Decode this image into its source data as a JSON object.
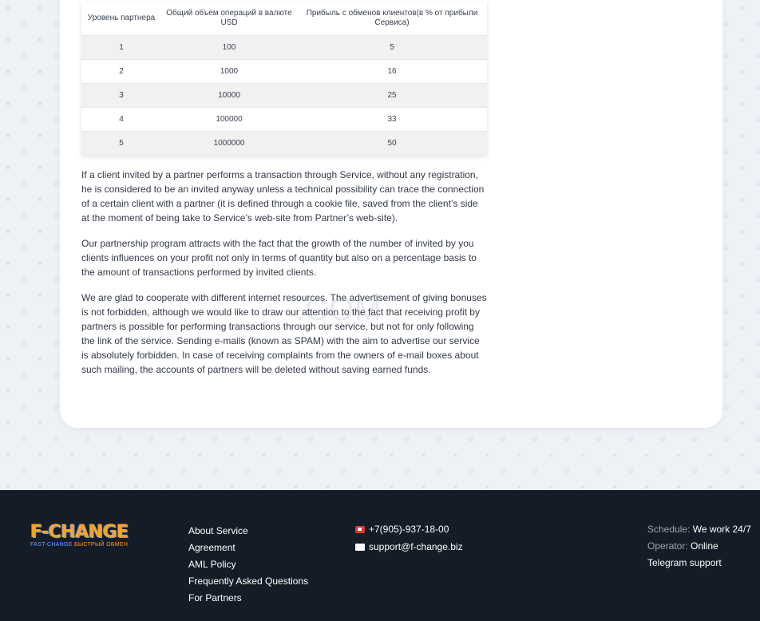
{
  "table": {
    "headers": [
      "Уровень партнера",
      "Общий объем операций в валюте USD",
      "Прибыль с обменов клиентов(в % от прибыли Сервиса)"
    ],
    "rows": [
      [
        "1",
        "100",
        "5"
      ],
      [
        "2",
        "1000",
        "16"
      ],
      [
        "3",
        "10000",
        "25"
      ],
      [
        "4",
        "100000",
        "33"
      ],
      [
        "5",
        "1000000",
        "50"
      ]
    ]
  },
  "paragraphs": [
    "If a client invited by a partner performs a transaction through Service, without any registration, he is considered to be an invited anyway unless a technical possibility can trace the connection of a certain client with a partner (it is defined through a cookie file, saved from the client’s side at the moment of being take to Service’s web-site from Partner’s web-site).",
    "Our partnership program attracts with the fact that the growth of the number of invited by you clients influences on your profit not only in terms of quantity but also on a percentage basis to the amount of transactions performed by invited clients.",
    "We are glad to cooperate with different internet resources. The advertisement of giving bonuses is not forbidden, although we would like to draw our attention to the fact that receiving profit by partners is possible for performing transactions through our service, but not for only following the link of the service. Sending e-mails (known as SPAM) with the aim to advertise our service is absolutely forbidden. In case of receiving complaints from the owners of e-mail boxes about such mailing, the accounts of partners will be deleted without saving earned funds."
  ],
  "watermark": ".COM",
  "footer": {
    "logo_main": "F-CHANGE",
    "logo_sub_left": "FAST-CHANGE",
    "logo_sub_right": "БЫСТРЫЙ ОБМЕН",
    "links": [
      "About Service",
      "Agreement",
      "AML Policy",
      "Frequently Asked Questions",
      "For Partners"
    ],
    "phone": "+7(905)-937-18-00",
    "email": "support@f-change.biz",
    "schedule_label": "Schedule:",
    "schedule_value": "We work 24/7",
    "operator_label": "Operator:",
    "operator_value": "Online",
    "telegram": "Telegram support"
  },
  "colors": {
    "footer_bg": "#141c27",
    "page_bg": "#eef1f6",
    "logo_orange": "#ffa321",
    "logo_blue": "#6aa6ff"
  }
}
